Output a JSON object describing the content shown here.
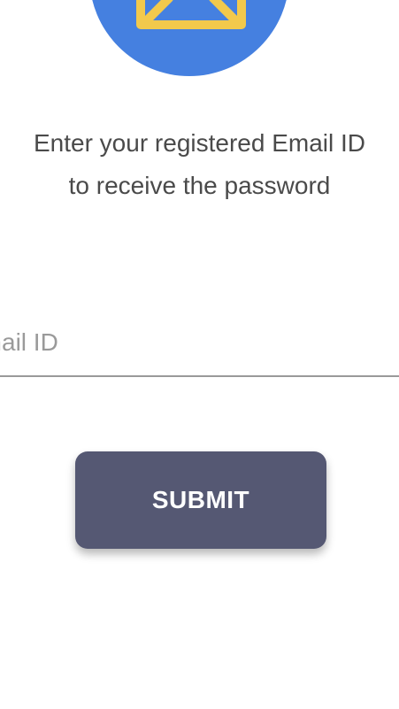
{
  "header": {
    "icon": "envelope-icon",
    "icon_color": "#f2c94c",
    "circle_color": "#4580e0"
  },
  "instruction": {
    "line1": "Enter your registered Email ID",
    "line2": "to receive the password"
  },
  "email_input": {
    "placeholder": "Email ID",
    "value": ""
  },
  "submit": {
    "label": "SUBMIT",
    "color": "#555873"
  }
}
